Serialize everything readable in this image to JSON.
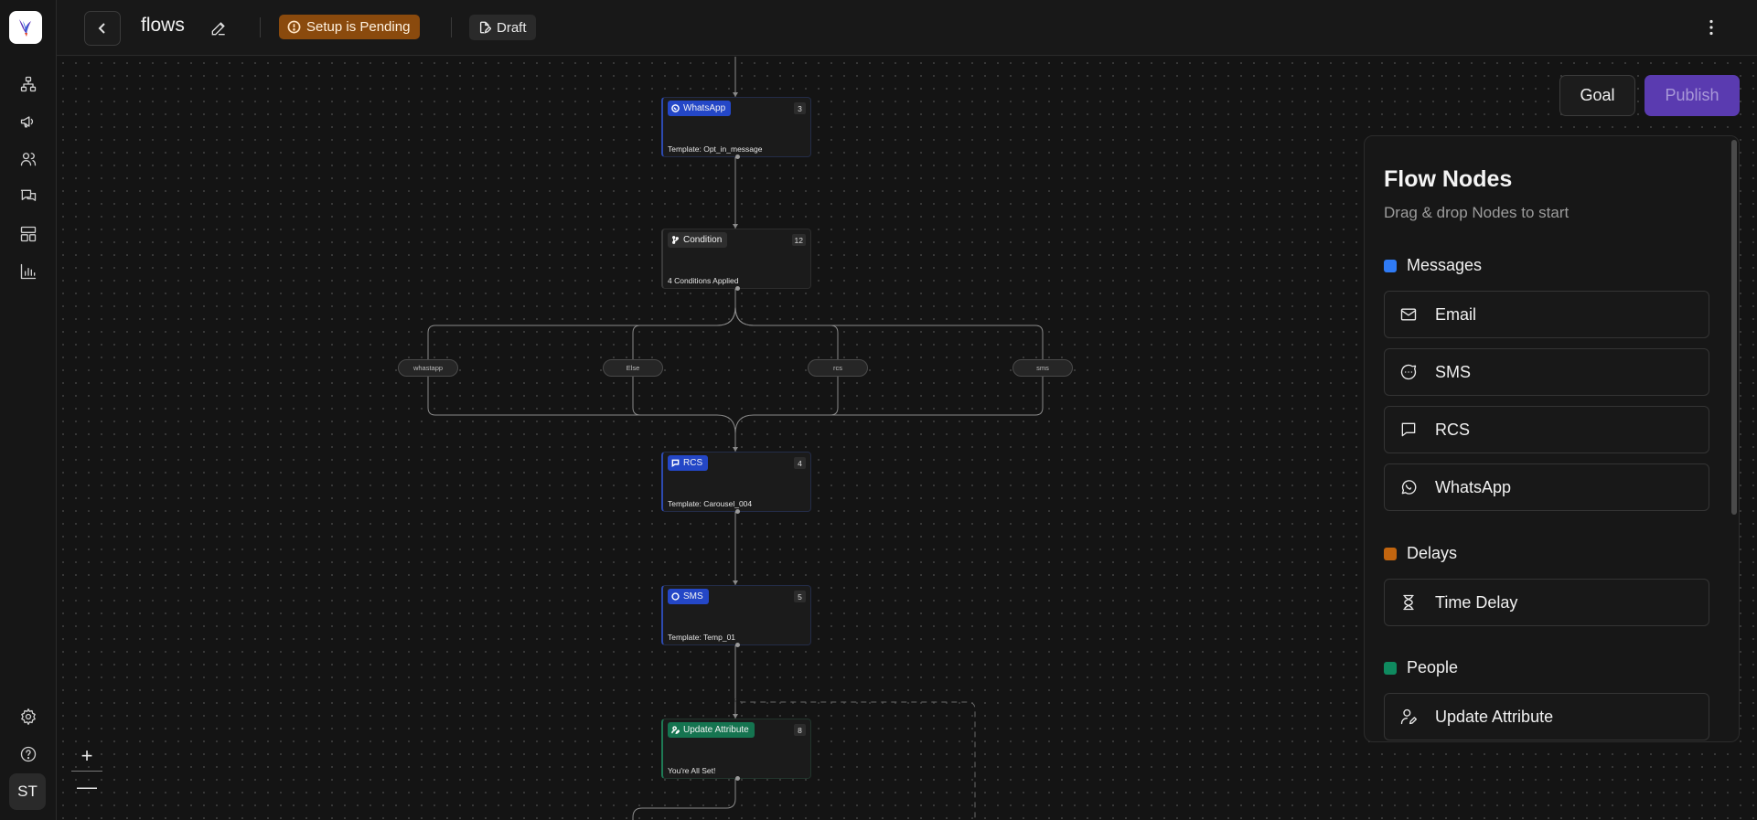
{
  "topbar": {
    "title": "flows",
    "status_badge": "Setup is Pending",
    "draft_badge": "Draft"
  },
  "user": {
    "initials": "ST"
  },
  "canvas": {
    "nodes": [
      {
        "type": "WhatsApp",
        "number": "3",
        "description": "Template: Opt_in_message",
        "color": "blue"
      },
      {
        "type": "Condition",
        "number": "12",
        "description": "4 Conditions Applied",
        "color": "grey"
      },
      {
        "type": "RCS",
        "number": "4",
        "description": "Template: Carousel_004",
        "color": "blue"
      },
      {
        "type": "SMS",
        "number": "5",
        "description": "Template: Temp_01",
        "color": "blue"
      },
      {
        "type": "Update Attribute",
        "number": "8",
        "description": "You're All Set!",
        "color": "green"
      }
    ],
    "branches": [
      "whastapp",
      "Else",
      "rcs",
      "sms"
    ],
    "zoom_in": "+",
    "zoom_out": "—"
  },
  "actions": {
    "goal_label": "Goal",
    "publish_label": "Publish"
  },
  "panel": {
    "title": "Flow Nodes",
    "subtitle": "Drag & drop Nodes to start",
    "sections": [
      {
        "name": "Messages",
        "color": "#2f7bf5",
        "items": [
          "Email",
          "SMS",
          "RCS",
          "WhatsApp"
        ]
      },
      {
        "name": "Delays",
        "color": "#c2650f",
        "items": [
          "Time Delay"
        ]
      },
      {
        "name": "People",
        "color": "#0f8a5f",
        "items": [
          "Update Attribute"
        ]
      }
    ]
  },
  "colors": {
    "accent_purple": "#5a3bb0",
    "pending_orange": "#8a4a0d",
    "node_blue": "#2447c7",
    "node_green": "#157450"
  }
}
